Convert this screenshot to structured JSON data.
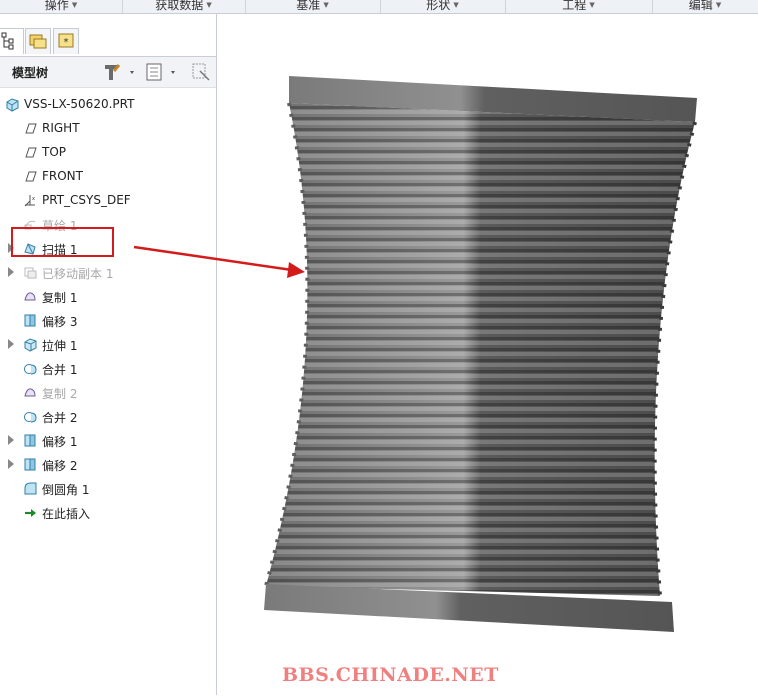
{
  "ribbon": {
    "groups": [
      {
        "label": "操作",
        "id": "operations"
      },
      {
        "label": "获取数据",
        "id": "get-data"
      },
      {
        "label": "基准",
        "id": "datum"
      },
      {
        "label": "形状",
        "id": "shapes"
      },
      {
        "label": "工程",
        "id": "engineering"
      },
      {
        "label": "编辑",
        "id": "edit"
      }
    ]
  },
  "panel": {
    "tabs": [
      {
        "icon": "model-tree-tab-icon"
      },
      {
        "icon": "folder-browser-tab-icon"
      },
      {
        "icon": "favorites-tab-icon"
      }
    ],
    "tree_title": "模型树",
    "tools": [
      "settings-tools-icon",
      "show-options-icon",
      "filter-icon"
    ]
  },
  "tree": {
    "items": [
      {
        "label": "VSS-LX-50620.PRT",
        "icon": "part-icon",
        "expandable": false,
        "dim": false
      },
      {
        "label": "RIGHT",
        "icon": "datum-plane-icon",
        "expandable": false,
        "dim": false
      },
      {
        "label": "TOP",
        "icon": "datum-plane-icon",
        "expandable": false,
        "dim": false
      },
      {
        "label": "FRONT",
        "icon": "datum-plane-icon",
        "expandable": false,
        "dim": false
      },
      {
        "label": "PRT_CSYS_DEF",
        "icon": "coordinate-system-icon",
        "expandable": false,
        "dim": false
      },
      {
        "label": "草绘 1",
        "icon": "sketch-icon",
        "expandable": false,
        "dim": true
      },
      {
        "label": "扫描 1",
        "icon": "sweep-icon",
        "expandable": true,
        "dim": false
      },
      {
        "label": "已移动副本 1",
        "icon": "moved-copy-icon",
        "expandable": true,
        "dim": true
      },
      {
        "label": "复制 1",
        "icon": "copy-icon",
        "expandable": false,
        "dim": false
      },
      {
        "label": "偏移 3",
        "icon": "offset-icon",
        "expandable": false,
        "dim": false
      },
      {
        "label": "拉伸 1",
        "icon": "extrude-icon",
        "expandable": true,
        "dim": false
      },
      {
        "label": "合并 1",
        "icon": "merge-icon",
        "expandable": false,
        "dim": false
      },
      {
        "label": "复制 2",
        "icon": "copy-icon",
        "expandable": false,
        "dim": true
      },
      {
        "label": "合并 2",
        "icon": "merge-icon",
        "expandable": false,
        "dim": false
      },
      {
        "label": "偏移 1",
        "icon": "offset-icon",
        "expandable": true,
        "dim": false
      },
      {
        "label": "偏移 2",
        "icon": "offset-icon",
        "expandable": true,
        "dim": false
      },
      {
        "label": "倒圆角 1",
        "icon": "round-icon",
        "expandable": false,
        "dim": false
      },
      {
        "label": "在此插入",
        "icon": "insert-here-icon",
        "expandable": false,
        "dim": false
      }
    ]
  },
  "annotation": {
    "highlight_color": "#d31b1b"
  },
  "watermark": "BBS.CHINADE.NET",
  "colors": {
    "highlight": "#d31b1b",
    "watermark": "#f08080",
    "model_light": "#8a8a8a",
    "model_dark": "#4e4e4e"
  }
}
